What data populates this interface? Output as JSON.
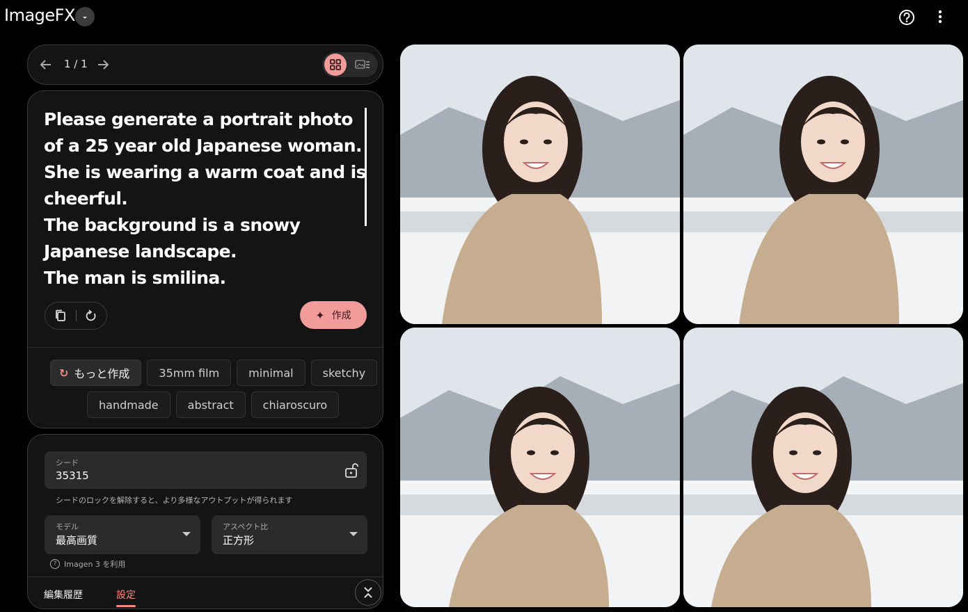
{
  "header": {
    "app_title": "ImageFX",
    "icons": [
      "chevron-down-icon",
      "help-icon",
      "more-vert-icon"
    ]
  },
  "pager": {
    "count": "1 / 1",
    "view_modes": [
      "grid-view-icon",
      "single-view-icon"
    ],
    "active_view": "grid"
  },
  "prompt": {
    "text": "Please generate a portrait photo of a 25 year old Japanese woman.\nShe is wearing a warm coat and is cheerful.\nThe background is a snowy Japanese landscape.\nThe man is smilina.",
    "create_label": "作成",
    "action_icons": [
      "copy-icon",
      "reset-icon"
    ]
  },
  "chips": {
    "more_label": "もっと作成",
    "row1": [
      "35mm film",
      "minimal",
      "sketchy"
    ],
    "row2": [
      "handmade",
      "abstract",
      "chiaroscuro"
    ]
  },
  "settings": {
    "seed_label": "シード",
    "seed_value": "35315",
    "seed_hint": "シードのロックを解除すると、より多様なアウトプットが得られます",
    "model_label": "モデル",
    "model_value": "最高画質",
    "aspect_label": "アスペクト比",
    "aspect_value": "正方形",
    "imagen_note": "Imagen 3 を利用",
    "tabs": [
      "編集履歴",
      "設定"
    ],
    "active_tab": "設定"
  },
  "images": {
    "count": 4,
    "subject": "woman-in-beige-fleece-coat-snowy-landscape",
    "colors": {
      "sky": "#dfe5ea",
      "mountains": "#8d98a3",
      "snow": "#f1f3f5",
      "hair": "#2a1f1a",
      "coat": "#c6ad8f",
      "skin": "#f1d8c8"
    }
  },
  "colors": {
    "accent": "#f29b9b",
    "accent_text": "#f28b82",
    "panel_bg": "#141414",
    "page_bg": "#000000"
  }
}
